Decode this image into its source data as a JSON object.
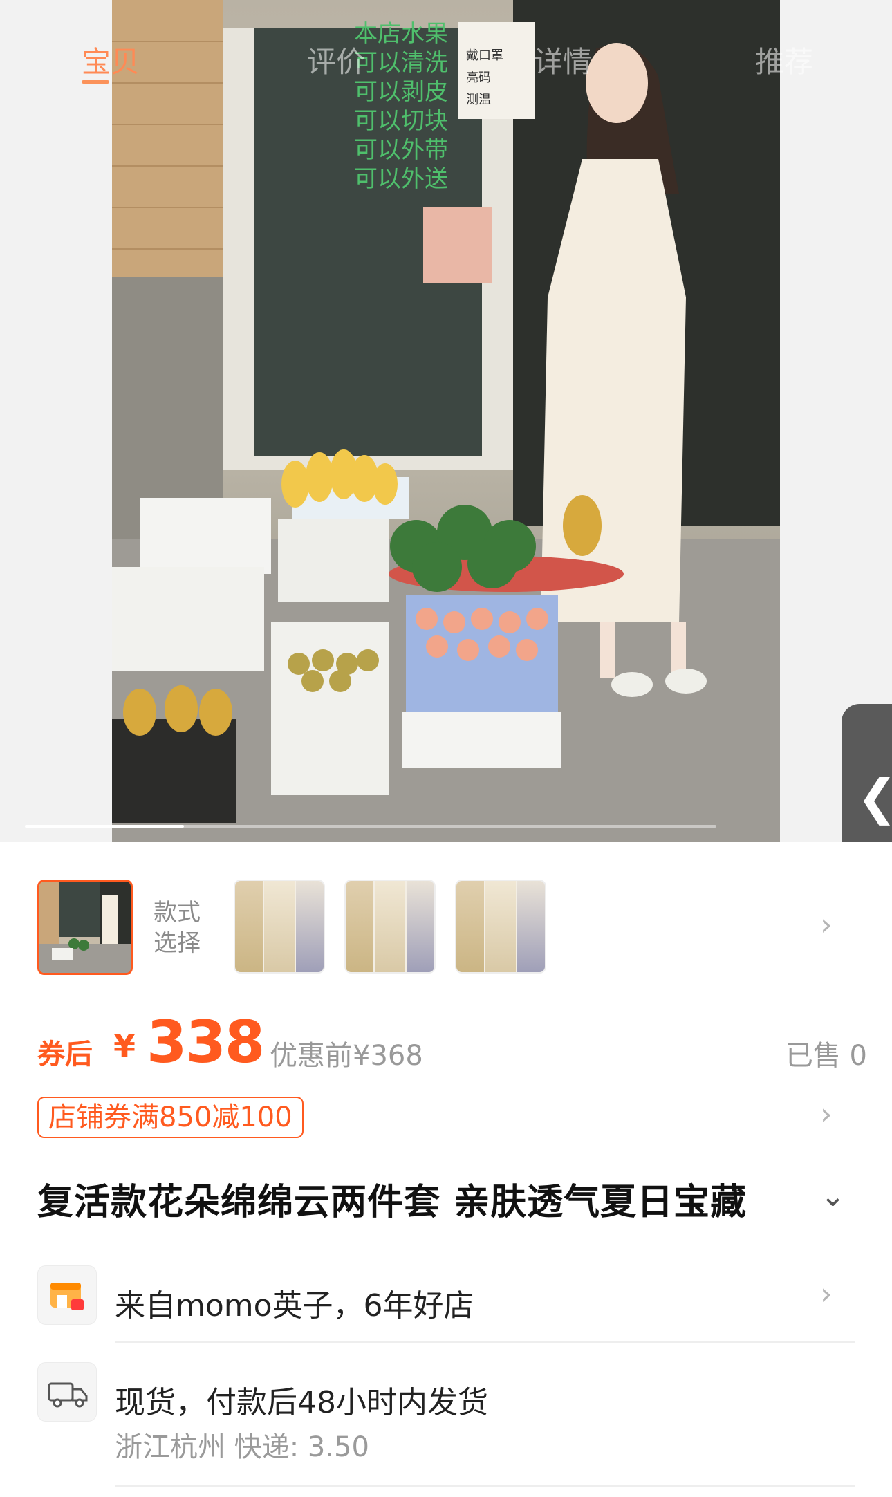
{
  "top_tabs": [
    "宝贝",
    "评价",
    "详情",
    "推荐"
  ],
  "gallery": {
    "progress_fraction": 0.23,
    "sign_text": [
      "本店水果",
      "可以清洗",
      "可以剥皮",
      "可以切块",
      "可以外带",
      "可以外送"
    ],
    "notice_text": [
      "戴口罩",
      "亮码",
      "测温"
    ]
  },
  "side_tab": {
    "icon": "chevron-left-icon"
  },
  "variants": {
    "label": "款式\n选择",
    "thumbs": 3,
    "arrow_icon": "chevron-right-icon"
  },
  "price": {
    "coupon_label": "券后",
    "currency": "¥",
    "value": "338",
    "original": "优惠前¥368",
    "sold": "已售 0"
  },
  "shop_coupon": "店铺券满850减100",
  "product_title": "复活款花朵绵绵云两件套 亲肤透气夏日宝藏",
  "shop_row": {
    "text": "来自momo英子，6年好店",
    "icon": "store-icon"
  },
  "shipping_row": {
    "text": "现货，付款后48小时内发货",
    "sub": "浙江杭州  快递: 3.50",
    "icon": "truck-icon"
  },
  "colors": {
    "accent": "#ff5a1f"
  }
}
